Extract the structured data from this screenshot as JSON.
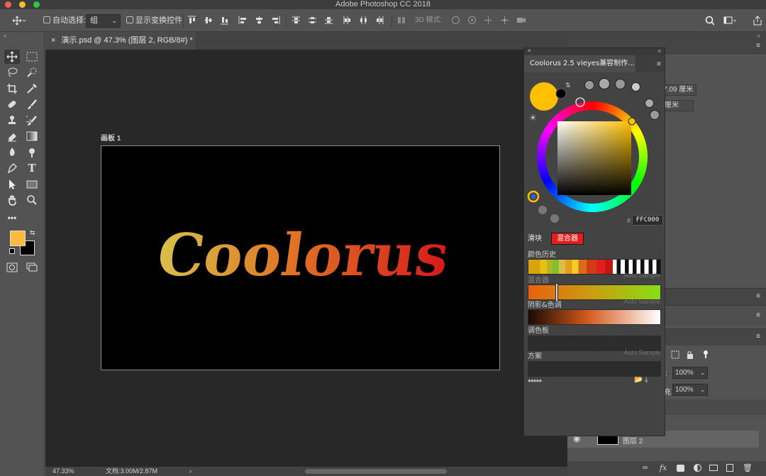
{
  "window": {
    "title": "Adobe Photoshop CC 2018"
  },
  "options_bar": {
    "auto_select_label": "自动选择:",
    "auto_select_value": "组",
    "show_transform_label": "显示变换控件",
    "mode_3d_label": "3D 模式:"
  },
  "document": {
    "tab_title": "演示.psd @ 47.3% (图层 2, RGB/8#) *",
    "artboard_label": "画板 1",
    "canvas_text": "Coolorus"
  },
  "status": {
    "zoom": "47.33%",
    "doc_size": "文档:3.00M/2.87M"
  },
  "right_panel": {
    "width_value": "7.09 厘米",
    "height_value": "厘米",
    "opacity_value": "100%",
    "fill_value": "100%",
    "fill_label": "充",
    "layer_name": "图层 2"
  },
  "coolorus": {
    "title": "Coolorus 2.5 vieyes兼容制作...",
    "hex_prefix": "#",
    "hex_value": "FFC000",
    "mode_tabs": [
      "滑块",
      "混合器"
    ],
    "sections": {
      "history": "颜色历史",
      "mixer": "混合器",
      "shades": "阴影&色调",
      "palette": "调色板",
      "scheme": "方案"
    },
    "auto_sample": "Auto Sample",
    "current_color": "#FFC000"
  },
  "colors": {
    "foreground": "#FDBA3C",
    "background": "#000000",
    "text_gradient_start": "#D8C14A",
    "text_gradient_mid": "#E07526",
    "text_gradient_end": "#D61A1A"
  }
}
